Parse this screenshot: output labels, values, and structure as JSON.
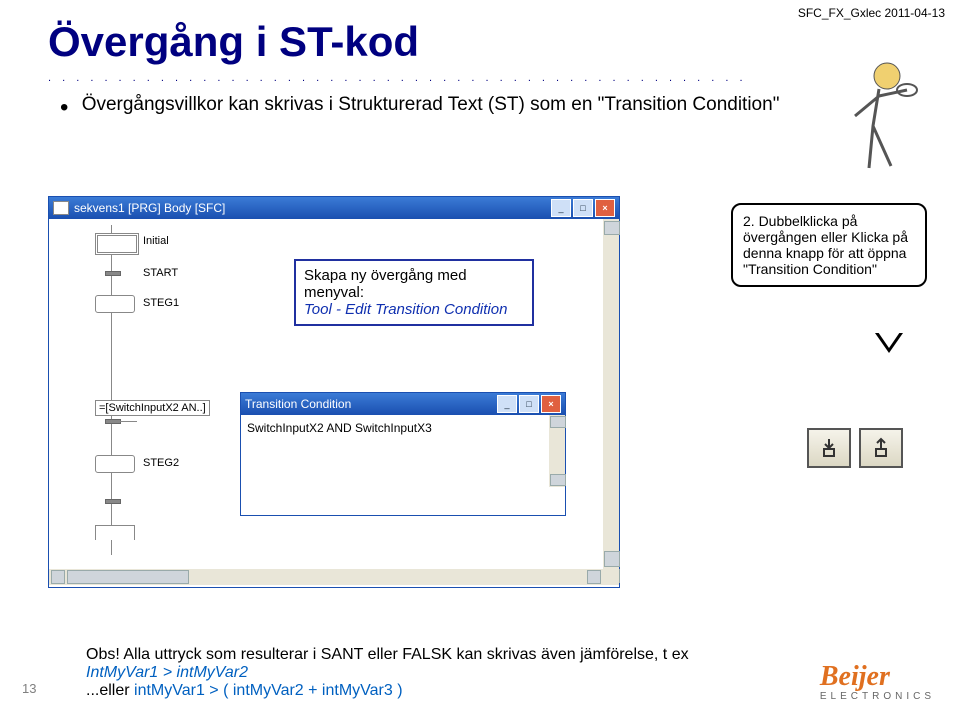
{
  "meta": {
    "header_right": "SFC_FX_Gxlec  2011-04-13"
  },
  "title": "Övergång i ST-kod",
  "bullet": "Övergångsvillkor kan skrivas i Strukturerad Text (ST) som en \"Transition Condition\"",
  "window1": {
    "title": "sekvens1 [PRG] Body [SFC]",
    "step_initial": "Initial",
    "trans_start": "START",
    "step1": "STEG1",
    "trans2_box": "=[SwitchInputX2 AN..]",
    "step2": "STEG2"
  },
  "callout1": {
    "line1": "Skapa ny övergång med menyval:",
    "line2": "Tool - Edit Transition Condition"
  },
  "bubble": {
    "text": "2. Dubbelklicka på övergången      eller Klicka på denna knapp för att öppna \"Transition Condition\""
  },
  "window2": {
    "title": "Transition Condition",
    "content": "SwitchInputX2 AND SwitchInputX3"
  },
  "note": {
    "line1a": "Obs! Alla uttryck som resulterar i SANT eller FALSK kan skrivas även jämförelse, t ex ",
    "line1b": "IntMyVar1 > intMyVar2",
    "line2a": "...eller ",
    "line2b": "intMyVar1 > ( intMyVar2 + intMyVar3 )"
  },
  "page_number": "13",
  "logo": {
    "brand": "Beijer",
    "sub": "ELECTRONICS"
  }
}
